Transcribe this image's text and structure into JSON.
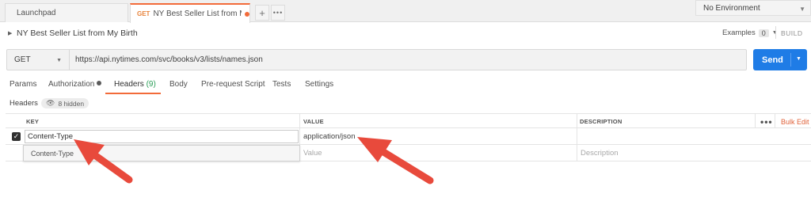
{
  "tabs": [
    {
      "title": "Launchpad"
    },
    {
      "method": "GET",
      "title": "NY Best Seller List from My Birth"
    }
  ],
  "environment": {
    "selected": "No Environment"
  },
  "request": {
    "name": "NY Best Seller List from My Birth",
    "examples_label": "Examples",
    "examples_count": "0",
    "build_label": "BUILD",
    "method": "GET",
    "url": "https://api.nytimes.com/svc/books/v3/lists/names.json",
    "send_label": "Send"
  },
  "subtabs": {
    "params": "Params",
    "authorization": "Authorization",
    "headers": "Headers",
    "headers_count": "(9)",
    "body": "Body",
    "prerequest": "Pre-request Script",
    "tests": "Tests",
    "settings": "Settings"
  },
  "headers_section": {
    "label": "Headers",
    "hidden_label": "8 hidden"
  },
  "table": {
    "columns": {
      "key": "KEY",
      "value": "VALUE",
      "description": "DESCRIPTION"
    },
    "bulk_edit": "Bulk Edit",
    "more": "•••",
    "rows": [
      {
        "key": "Content-Type",
        "value": "application/json",
        "description": ""
      }
    ],
    "new_row": {
      "value_placeholder": "Value",
      "description_placeholder": "Description"
    },
    "autocomplete": [
      "Content-Type"
    ]
  },
  "colors": {
    "accent": "#f26b3a",
    "send": "#1f7ce6",
    "arrow": "#e84a3c",
    "headers_count": "#2a9d57"
  }
}
